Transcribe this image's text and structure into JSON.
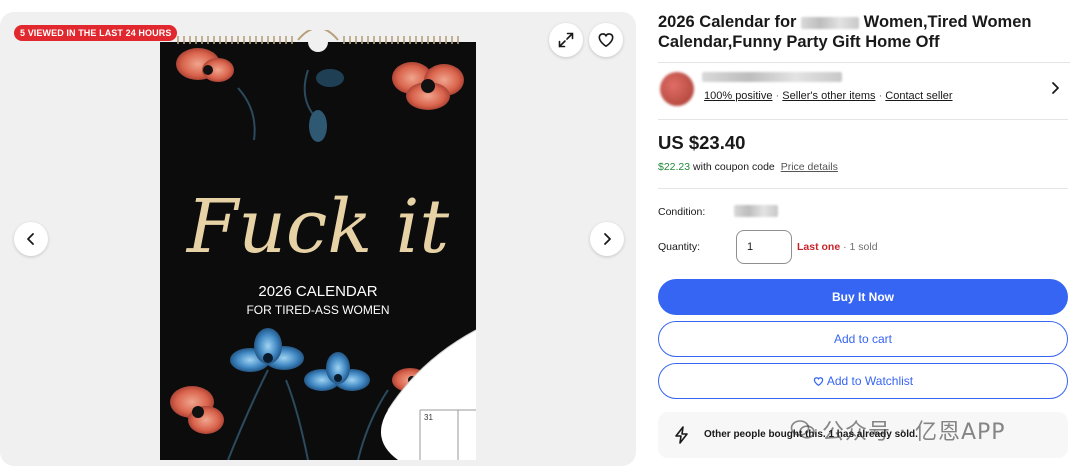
{
  "gallery": {
    "badge": "5 VIEWED IN THE LAST 24 HOURS",
    "icons": [
      "expand-icon",
      "heart-icon",
      "chevron-left-icon",
      "chevron-right-icon"
    ],
    "calendar_art": {
      "headline": "Fuck it",
      "subtitle_line1": "2026 CALENDAR",
      "subtitle_line2": "FOR TIRED-ASS WOMEN",
      "date_cell": "31",
      "background_color": "#0c0c0c",
      "headline_color": "#e7d2a6"
    }
  },
  "listing": {
    "title_part1": "2026 Calendar for",
    "title_part2": "Women,Tired Women Calendar,Funny Party Gift Home Off"
  },
  "seller": {
    "positive": "100% positive",
    "other_items": "Seller's other items",
    "contact": "Contact seller",
    "separator": "·"
  },
  "price": {
    "main": "US $23.40",
    "coupon_price": "$22.23",
    "coupon_text": "with coupon code",
    "details_link": "Price details"
  },
  "details": {
    "condition_label": "Condition:",
    "quantity_label": "Quantity:",
    "quantity_value": "1",
    "last_one": "Last one",
    "dot": "·",
    "sold": "1 sold"
  },
  "actions": {
    "buy_now": "Buy It Now",
    "add_to_cart": "Add to cart",
    "add_to_watchlist": "Add to Watchlist"
  },
  "social_proof": {
    "text": "Other people bought this. 1 has already sold."
  },
  "watermark": {
    "text": "公众号 · 亿恩APP"
  },
  "colors": {
    "accent": "#3665f3",
    "badge_red": "#e0282e",
    "coupon_green": "#1f8a36",
    "last_one_red": "#c6242b"
  }
}
